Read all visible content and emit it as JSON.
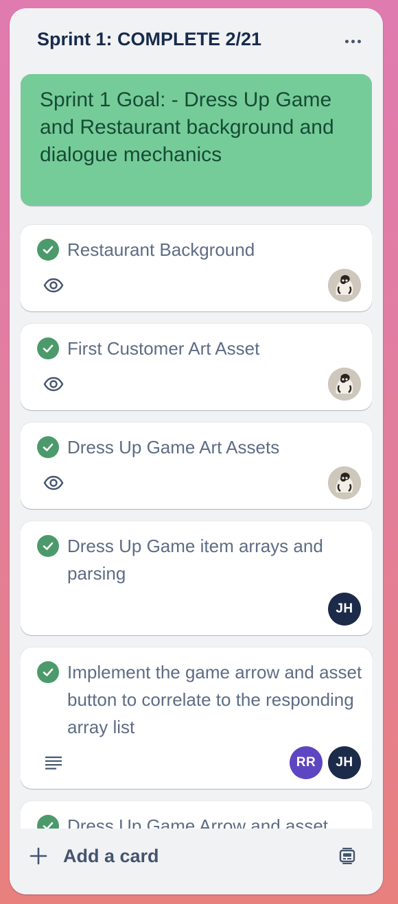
{
  "list": {
    "title": "Sprint 1: COMPLETE 2/21",
    "menu_icon": "more-horizontal-icon"
  },
  "goal_card": {
    "title": "Sprint 1 Goal: - Dress Up Game and Restaurant background and dialogue mechanics",
    "color": "#75cc98"
  },
  "cards": [
    {
      "title": "Restaurant Background",
      "complete": true,
      "badge": "eye-icon",
      "members": [
        "photo"
      ]
    },
    {
      "title": "First Customer Art Asset",
      "complete": true,
      "badge": "eye-icon",
      "members": [
        "photo"
      ]
    },
    {
      "title": "Dress Up Game Art Assets",
      "complete": true,
      "badge": "eye-icon",
      "members": [
        "photo"
      ]
    },
    {
      "title": "Dress Up Game item arrays and parsing",
      "complete": true,
      "badge": "",
      "members": [
        "JH"
      ]
    },
    {
      "title": "Implement the game arrow and asset button to correlate to the responding array list",
      "complete": true,
      "badge": "description-icon",
      "members": [
        "RR",
        "JH"
      ]
    },
    {
      "title": "Dress Up Game Arrow and asset",
      "complete": true,
      "badge": "",
      "members": []
    }
  ],
  "members": {
    "JH": {
      "initials": "JH",
      "color": "#1c2b4a"
    },
    "RR": {
      "initials": "RR",
      "color": "#5e46c2"
    }
  },
  "footer": {
    "add_card_label": "Add a card",
    "add_icon": "plus-icon",
    "template_icon": "card-template-icon"
  },
  "colors": {
    "complete_check": "#4c9a6b",
    "list_bg": "#f1f2f4",
    "title_text": "#172b4d"
  }
}
